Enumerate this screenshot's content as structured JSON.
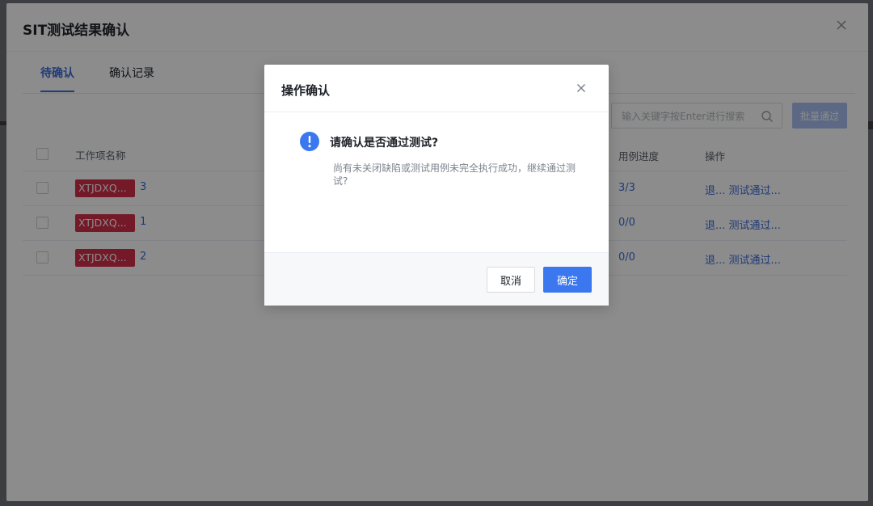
{
  "outer_modal": {
    "title": "SIT测试结果确认",
    "tabs": [
      {
        "label": "待确认",
        "active": true
      },
      {
        "label": "确认记录",
        "active": false
      }
    ],
    "search": {
      "placeholder": "输入关键字按Enter进行搜索"
    },
    "batch_button": "批量通过",
    "table": {
      "headers": {
        "name": "工作项名称",
        "progress": "用例进度",
        "ops": "操作"
      },
      "rows": [
        {
          "tag": "XTJDXQ...",
          "num": "3",
          "progress": "3/3",
          "op1": "退...",
          "op2": "测试通过..."
        },
        {
          "tag": "XTJDXQ...",
          "num": "1",
          "progress": "0/0",
          "op1": "退...",
          "op2": "测试通过..."
        },
        {
          "tag": "XTJDXQ...",
          "num": "2",
          "progress": "0/0",
          "op1": "退...",
          "op2": "测试通过..."
        }
      ]
    }
  },
  "dialog": {
    "title": "操作确认",
    "question": "请确认是否通过测试?",
    "description": "尚有未关闭缺陷或测试用例未完全执行成功，继续通过测试?",
    "cancel_label": "取消",
    "ok_label": "确定"
  },
  "colors": {
    "accent": "#3b6cd8",
    "primary_button": "#3b78f0",
    "tag_red": "#d42f49",
    "mask": "rgba(0,0,0,0.45)"
  },
  "icons": [
    "close-icon",
    "search-icon",
    "info-icon"
  ]
}
